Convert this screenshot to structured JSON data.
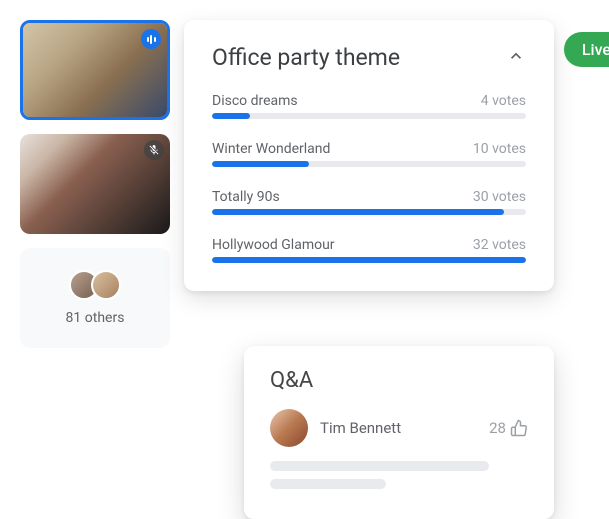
{
  "live_badge": "Live",
  "sidebar": {
    "participants": [
      {
        "name": "participant-1",
        "status": "speaking"
      },
      {
        "name": "participant-2",
        "status": "muted"
      }
    ],
    "others_label": "81 others"
  },
  "poll": {
    "title": "Office party theme",
    "options": [
      {
        "name": "Disco dreams",
        "votes_label": "4 votes",
        "percent": 12
      },
      {
        "name": "Winter Wonderland",
        "votes_label": "10 votes",
        "percent": 31
      },
      {
        "name": "Totally 90s",
        "votes_label": "30 votes",
        "percent": 93
      },
      {
        "name": "Hollywood Glamour",
        "votes_label": "32 votes",
        "percent": 100
      }
    ]
  },
  "qa": {
    "title": "Q&A",
    "author": "Tim Bennett",
    "upvotes": "28"
  }
}
